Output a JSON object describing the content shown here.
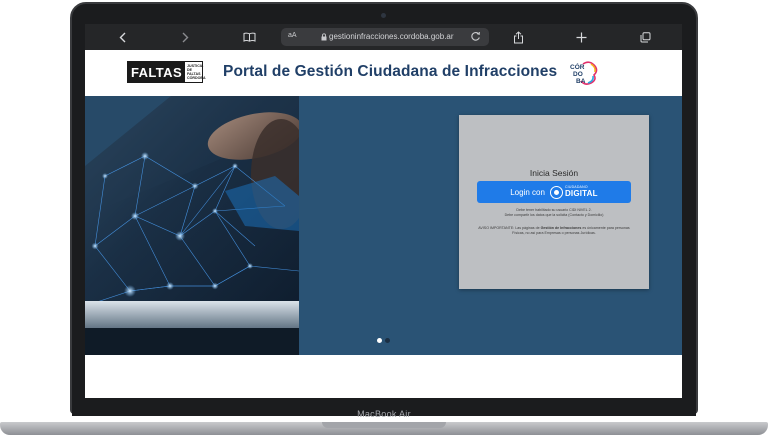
{
  "device": {
    "label": "MacBook Air"
  },
  "browser": {
    "aa_label": "aA",
    "url": "gestioninfracciones.cordoba.gob.ar",
    "icons": [
      "back-icon",
      "forward-icon",
      "book-icon",
      "lock-icon",
      "reload-icon",
      "share-icon",
      "plus-icon",
      "tabs-icon"
    ]
  },
  "header": {
    "faltas_logo": {
      "word": "FALTAS",
      "sub": [
        "JUSTICIA",
        "DE",
        "FALTAS",
        "CÓRDOBA"
      ]
    },
    "title": "Portal de Gestión Ciudadana de Infracciones",
    "title_color": "#203f67",
    "cordoba_logo": [
      "CÓR",
      "DO",
      "BA"
    ]
  },
  "login": {
    "title": "Inicia Sesión",
    "button_label": "Login con",
    "badge_small": "CIUDADANO",
    "badge_big": "DIGITAL",
    "button_color": "#1f7be8",
    "note_line1": "Debe tener habilitado su usuario CIDI NIVEL 2.",
    "note_line2": "Debe compartir los datos que la solicita (Contacto y Domicilio)",
    "warning_prefix": "AVISO IMPORTANTE: Las páginas de",
    "warning_bold": "Gestión de Infracciones",
    "warning_suffix": "es únicamente para personas Físicas, no así para Empresas o personas Jurídicas."
  },
  "hero": {
    "background_color": "#2a5375",
    "carousel": {
      "total": 2,
      "active_index": 0
    }
  }
}
